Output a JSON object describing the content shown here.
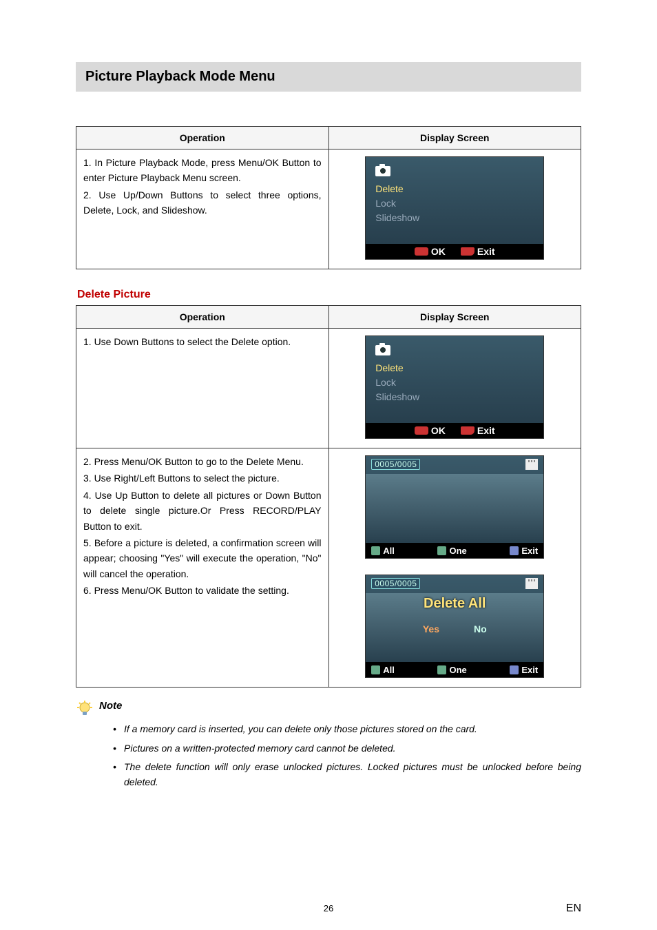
{
  "title_bar": "Picture Playback Mode Menu",
  "table1": {
    "headers": {
      "op": "Operation",
      "ds": "Display Screen"
    },
    "ops": [
      "1. In Picture Playback Mode, press Menu/OK Button to enter Picture Playback Menu screen.",
      "2. Use Up/Down Buttons to select three options, Delete, Lock, and Slideshow."
    ],
    "screen": {
      "menu": {
        "delete": "Delete",
        "lock": "Lock",
        "slideshow": "Slideshow"
      },
      "foot": {
        "ok": "OK",
        "exit": "Exit"
      }
    }
  },
  "section2_title": "Delete Picture",
  "table2": {
    "headers": {
      "op": "Operation",
      "ds": "Display Screen"
    },
    "row1": {
      "op": "1. Use Down Buttons to select the Delete option.",
      "screen": {
        "menu": {
          "delete": "Delete",
          "lock": "Lock",
          "slideshow": "Slideshow"
        },
        "foot": {
          "ok": "OK",
          "exit": "Exit"
        }
      }
    },
    "row2": {
      "ops": [
        "2. Press Menu/OK Button to go to the Delete Menu.",
        "3. Use Right/Left Buttons to select the picture.",
        "4. Use Up Button to delete all pictures or Down Button to delete single picture.Or Press RECORD/PLAY Button to exit.",
        "5. Before a picture is deleted, a confirmation screen will appear; choosing \"Yes\" will execute the operation, \"No\" will cancel the operation.",
        "6. Press Menu/OK Button to validate the setting."
      ],
      "screenA": {
        "counter": "0005/0005",
        "foot": {
          "all": "All",
          "one": "One",
          "exit": "Exit"
        }
      },
      "screenB": {
        "counter": "0005/0005",
        "title": "Delete All",
        "yes": "Yes",
        "no": "No",
        "foot": {
          "all": "All",
          "one": "One",
          "exit": "Exit"
        }
      }
    }
  },
  "note_label": "Note",
  "notes": [
    "If a memory card is inserted, you can delete only those pictures stored on the card.",
    "Pictures on a written-protected memory card cannot be deleted.",
    "The delete function will only erase unlocked pictures. Locked pictures must be unlocked before being deleted."
  ],
  "page_number": "26",
  "page_lang": "EN"
}
